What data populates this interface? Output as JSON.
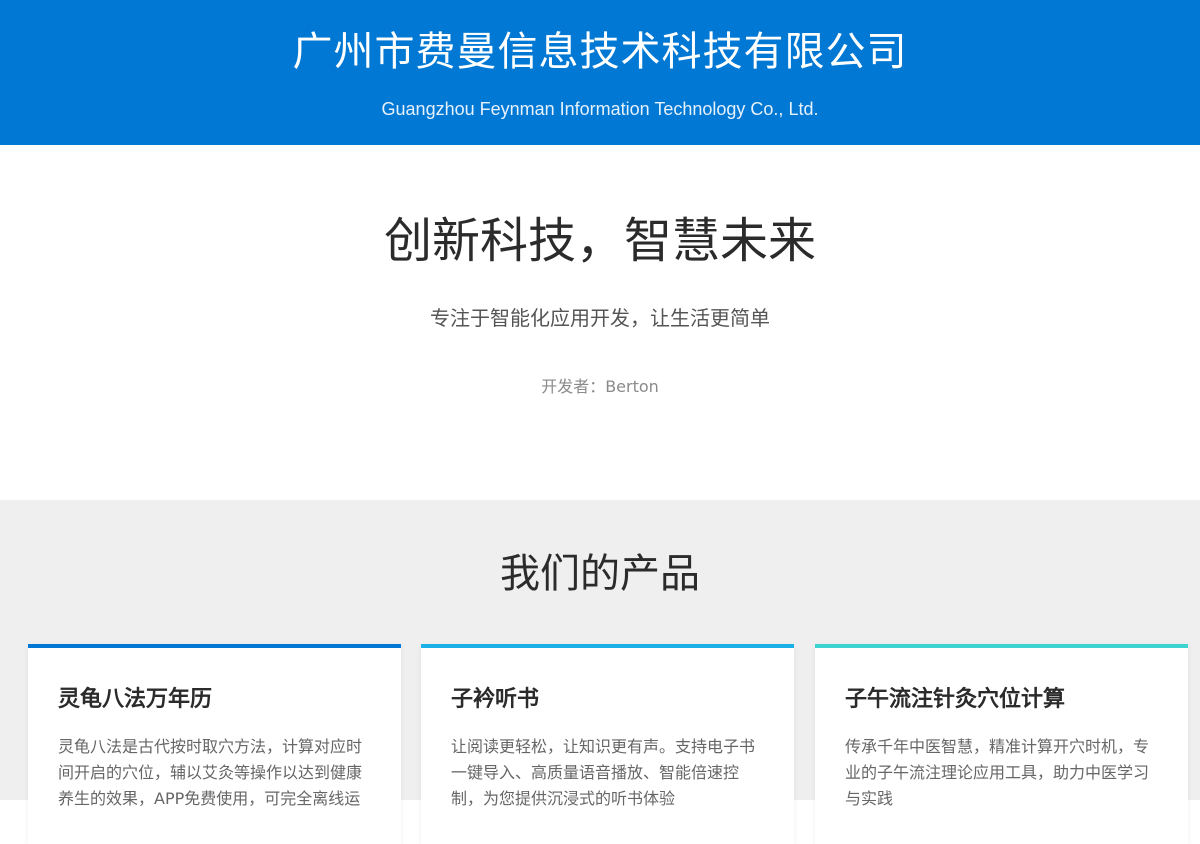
{
  "header": {
    "company_name": "广州市费曼信息技术科技有限公司",
    "company_name_en": "Guangzhou Feynman Information Technology Co., Ltd.",
    "background_color": "#0078d4"
  },
  "hero": {
    "headline": "创新科技，智慧未来",
    "tagline": "专注于智能化应用开发，让生活更简单",
    "developer": "开发者：Berton"
  },
  "products": {
    "section_title": "我们的产品",
    "items": [
      {
        "title": "灵龟八法万年历",
        "description": "灵龟八法是古代按时取穴方法，计算对应时间开启的穴位，辅以艾灸等操作以达到健康养生的效果，APP免费使用，可完全离线运",
        "accent_color": "#0078d4"
      },
      {
        "title": "子衿听书",
        "description": "让阅读更轻松，让知识更有声。支持电子书一键导入、高质量语音播放、智能倍速控制，为您提供沉浸式的听书体验",
        "accent_color": "#1ab0e8"
      },
      {
        "title": "子午流注针灸穴位计算",
        "description": "传承千年中医智慧，精准计算开穴时机，专业的子午流注理论应用工具，助力中医学习与实践",
        "accent_color": "#3dd3d0"
      }
    ]
  }
}
